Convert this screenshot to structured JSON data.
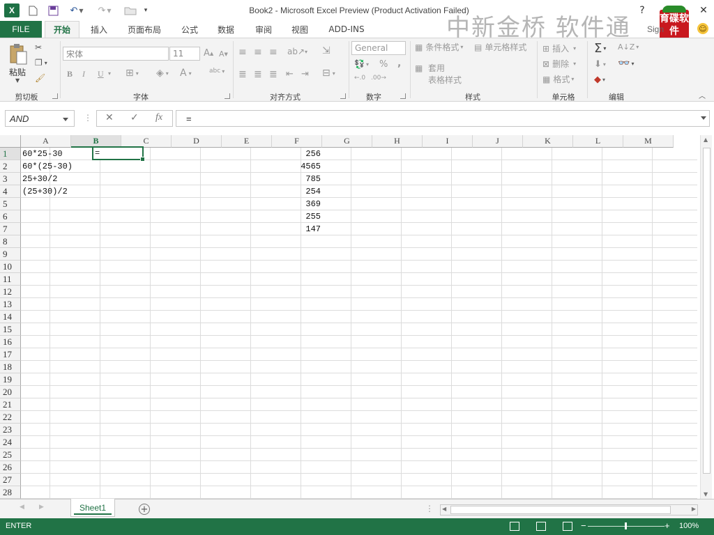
{
  "window": {
    "title": "Book2 - Microsoft Excel Preview (Product Activation Failed)",
    "watermark": "中新金桥 软件通",
    "badge": "育碟软件",
    "sign_in": "Sign"
  },
  "ribbon_tabs": [
    {
      "label": "FILE"
    },
    {
      "label": "开始"
    },
    {
      "label": "插入"
    },
    {
      "label": "页面布局"
    },
    {
      "label": "公式"
    },
    {
      "label": "数据"
    },
    {
      "label": "审阅"
    },
    {
      "label": "视图"
    },
    {
      "label": "ADD-INS"
    }
  ],
  "ribbon": {
    "clipboard": {
      "paste": "粘贴",
      "label": "剪切板"
    },
    "font": {
      "name": "宋体",
      "size": "11",
      "bold": "B",
      "italic": "I",
      "underline": "U",
      "label": "字体"
    },
    "alignment": {
      "label": "对齐方式"
    },
    "number": {
      "format": "General",
      "percent": "%",
      "comma": ",",
      "label": "数字"
    },
    "styles": {
      "conditional": "条件格式",
      "cell_styles": "单元格样式",
      "table_1": "套用",
      "table_2": "表格样式",
      "label": "样式"
    },
    "cells": {
      "insert": "插入",
      "delete": "删除",
      "format": "格式",
      "label": "单元格"
    },
    "editing": {
      "label": "编辑"
    }
  },
  "formula_bar": {
    "name_box": "AND",
    "fx": "fx",
    "formula": "="
  },
  "grid": {
    "columns": [
      "A",
      "B",
      "C",
      "D",
      "E",
      "F",
      "G",
      "H",
      "I",
      "J",
      "K",
      "L",
      "M"
    ],
    "selected_column": "B",
    "rows": [
      "1",
      "2",
      "3",
      "4",
      "5",
      "6",
      "7",
      "8",
      "9",
      "10",
      "11",
      "12",
      "13",
      "14",
      "15",
      "16",
      "17",
      "18",
      "19",
      "20",
      "21",
      "22",
      "23",
      "24",
      "25",
      "26",
      "27",
      "28"
    ],
    "selected_row": "1",
    "col_a": [
      "60*25-30",
      "60*(25-30)",
      "25+30/2",
      "(25+30)/2"
    ],
    "col_f": [
      "256",
      "4565",
      "785",
      "254",
      "369",
      "255",
      "147"
    ],
    "active_cell_value": "="
  },
  "sheets": [
    {
      "label": "Sheet1"
    }
  ],
  "status": {
    "mode": "ENTER",
    "zoom": "100%"
  },
  "colors": {
    "accent": "#217346"
  }
}
